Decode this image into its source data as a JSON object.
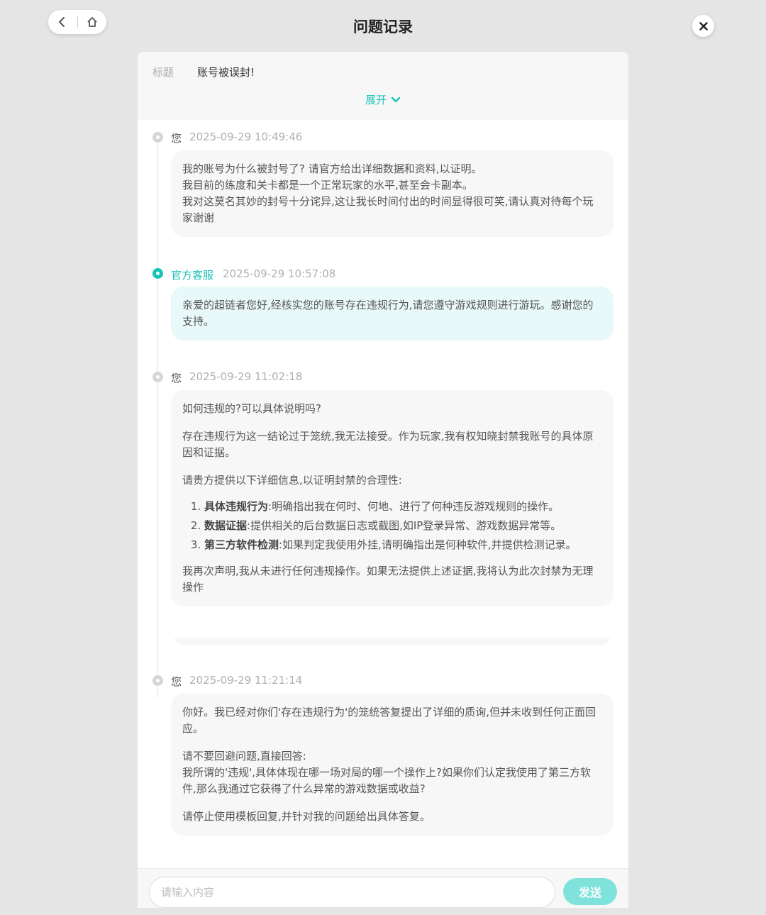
{
  "header": {
    "title": "问题记录",
    "back_icon": "chevron-left-icon",
    "home_icon": "home-icon",
    "close_icon": "close-icon"
  },
  "ticket": {
    "subject_label": "标题",
    "subject_value": "账号被误封!",
    "expand_label": "展开"
  },
  "messages": [
    {
      "sender": "您",
      "time": "2025-09-29 10:49:46",
      "paragraphs": [
        "我的账号为什么被封号了? 请官方给出详细数据和资料,以证明。\n我目前的练度和关卡都是一个正常玩家的水平,甚至会卡副本。\n我对这莫名其妙的封号十分诧异,这让我长时间付出的时间显得很可笑,请认真对待每个玩家谢谢"
      ]
    },
    {
      "sender": "官方客服",
      "time": "2025-09-29 10:57:08",
      "paragraphs": [
        "亲爱的超链者您好,经核实您的账号存在违规行为,请您遵守游戏规则进行游玩。感谢您的支持。"
      ]
    },
    {
      "sender": "您",
      "time": "2025-09-29 11:02:18",
      "paragraphs": [
        "如何违规的?可以具体说明吗?",
        "存在违规行为这一结论过于笼统,我无法接受。作为玩家,我有权知晓封禁我账号的具体原因和证据。",
        "请贵方提供以下详细信息,以证明封禁的合理性:"
      ],
      "list": [
        {
          "bold": "具体违规行为",
          "text": ":明确指出我在何时、何地、进行了何种违反游戏规则的操作。"
        },
        {
          "bold": "数据证据",
          "text": ":提供相关的后台数据日志或截图,如IP登录异常、游戏数据异常等。"
        },
        {
          "bold": "第三方软件检测",
          "text": ":如果判定我使用外挂,请明确指出是何种软件,并提供检测记录。"
        }
      ],
      "closing": "我再次声明,我从未进行任何违规操作。如果无法提供上述证据,我将认为此次封禁为无理操作"
    },
    {
      "sender": "您",
      "time": "2025-09-29 11:21:14",
      "paragraphs": [
        "你好。我已经对你们'存在违规行为'的笼统答复提出了详细的质询,但并未收到任何正面回应。",
        "请不要回避问题,直接回答:\n我所谓的'违规',具体体现在哪一场对局的哪一个操作上?如果你们认定我使用了第三方软件,那么我通过它获得了什么异常的游戏数据或收益?",
        "请停止使用模板回复,并针对我的问题给出具体答复。"
      ]
    }
  ],
  "composer": {
    "placeholder": "请输入内容",
    "send_label": "发送"
  },
  "colors": {
    "accent": "#18c3b8",
    "send_button": "#7fe3dc",
    "official_bubble": "#e9f8f8"
  }
}
